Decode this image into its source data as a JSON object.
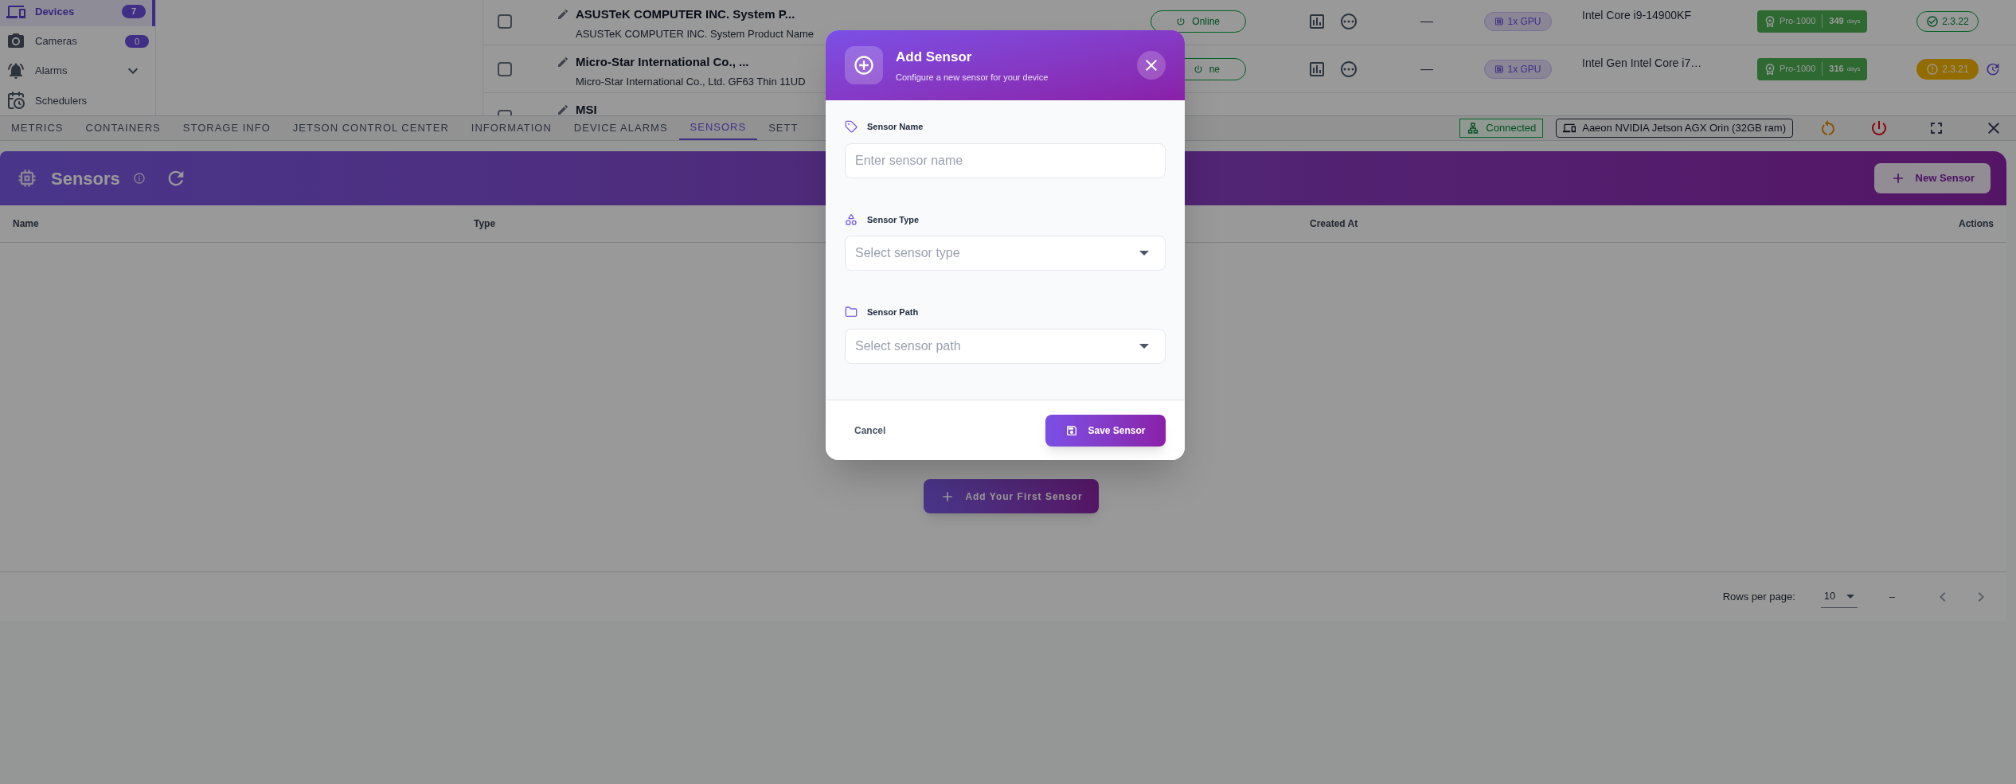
{
  "sidebar": {
    "items": [
      {
        "label": "Devices",
        "kind": "badge",
        "badge": "7",
        "selected": true
      },
      {
        "label": "Cameras",
        "kind": "badge",
        "badge": "0",
        "selected": false
      },
      {
        "label": "Alarms",
        "kind": "expandable",
        "selected": false
      },
      {
        "label": "Schedulers",
        "kind": "plain",
        "selected": false
      }
    ]
  },
  "devices_table": {
    "rows": [
      {
        "title": "ASUSTeK COMPUTER INC. System P...",
        "subtitle": "ASUSTeK COMPUTER INC. System Product Name",
        "checked": false,
        "status": "Online",
        "column_5": "—",
        "gpu": "1x GPU",
        "cpu": "Intel Core i9-14900KF",
        "license": "Pro-1000",
        "days": "349",
        "days_unit": "days",
        "version": "2.3.22",
        "warning": false
      },
      {
        "title": "Micro-Star International Co., ...",
        "subtitle": "Micro-Star International Co., Ltd. GF63 Thin 11UD",
        "checked": false,
        "status": "ne",
        "column_5": "—",
        "gpu": "1x GPU",
        "cpu": "Intel Gen Intel Core i7…",
        "license": "Pro-1000",
        "days": "316",
        "days_unit": "days",
        "version": "2.3.21",
        "warning": true
      },
      {
        "title": "MSI",
        "checked": false
      }
    ]
  },
  "tabs": [
    {
      "label": "METRICS",
      "selected": false
    },
    {
      "label": "CONTAINERS",
      "selected": false
    },
    {
      "label": "STORAGE INFO",
      "selected": false
    },
    {
      "label": "JETSON CONTROL CENTER",
      "selected": false
    },
    {
      "label": "INFORMATION",
      "selected": false
    },
    {
      "label": "DEVICE ALARMS",
      "selected": false
    },
    {
      "label": "SENSORS",
      "selected": true
    },
    {
      "label": "SETT",
      "selected": false
    }
  ],
  "connection": {
    "label": "Connected"
  },
  "device": {
    "label": "Aaeon NVIDIA Jetson AGX Orin (32GB ram)"
  },
  "sensors_panel": {
    "title": "Sensors",
    "new_button": "New Sensor",
    "columns": [
      "Name",
      "Type",
      "Created At",
      "Actions"
    ],
    "empty_button": "Add Your First Sensor",
    "pagination": {
      "rows_per_page_label": "Rows per page:",
      "rows_per_page": "10",
      "range": "–"
    }
  },
  "dialog": {
    "title": "Add Sensor",
    "subtitle": "Configure a new sensor for your device",
    "fields": [
      {
        "label": "Sensor Name",
        "kind": "text",
        "placeholder": "Enter sensor name"
      },
      {
        "label": "Sensor Type",
        "kind": "select",
        "placeholder": "Select sensor type"
      },
      {
        "label": "Sensor Path",
        "kind": "select",
        "placeholder": "Select sensor path"
      }
    ],
    "cancel": "Cancel",
    "save": "Save Sensor"
  }
}
